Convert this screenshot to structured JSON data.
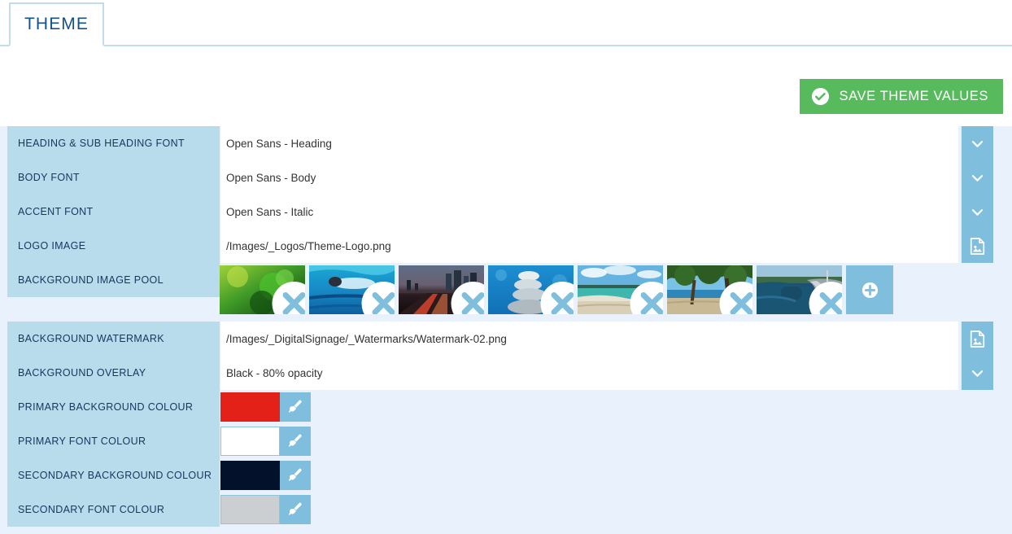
{
  "tab": {
    "label": "THEME"
  },
  "toolbar": {
    "save_label": "SAVE THEME VALUES",
    "save_color": "#57bb5e",
    "save_icon": "check-circle-icon"
  },
  "colors": {
    "label_bg": "#b9dcec",
    "table_bg": "#e9f2fc",
    "action_bg": "#7fbedd",
    "label_text": "#16365f",
    "tab_text": "#15528c",
    "tab_border": "#bfdeea"
  },
  "rows": [
    {
      "label": "HEADING & SUB HEADING FONT",
      "value": "Open Sans - Heading",
      "action_icon": "chevron-down-icon",
      "type": "select"
    },
    {
      "label": "BODY FONT",
      "value": "Open Sans - Body",
      "action_icon": "chevron-down-icon",
      "type": "select"
    },
    {
      "label": "ACCENT FONT",
      "value": "Open Sans - Italic",
      "action_icon": "chevron-down-icon",
      "type": "select"
    },
    {
      "label": "LOGO IMAGE",
      "value": "/Images/_Logos/Theme-Logo.png",
      "action_icon": "image-picker-icon",
      "type": "image"
    }
  ],
  "image_pool": {
    "label": "BACKGROUND IMAGE POOL",
    "add_icon": "plus-circle-icon",
    "remove_icon": "remove-circle-icon",
    "thumbnails": [
      {
        "name": "clover-leaf-thumbnail"
      },
      {
        "name": "swimmer-underwater-thumbnail"
      },
      {
        "name": "city-highway-night-thumbnail"
      },
      {
        "name": "stacked-stones-thumbnail"
      },
      {
        "name": "beach-coastline-thumbnail"
      },
      {
        "name": "trees-by-sea-thumbnail"
      },
      {
        "name": "riverside-path-thumbnail"
      }
    ]
  },
  "rows_after_pool": [
    {
      "label": "BACKGROUND WATERMARK",
      "value": "/Images/_DigitalSignage/_Watermarks/Watermark-02.png",
      "action_icon": "image-picker-icon",
      "type": "image"
    },
    {
      "label": "BACKGROUND OVERLAY",
      "value": "Black - 80% opacity",
      "action_icon": "chevron-down-icon",
      "type": "select"
    }
  ],
  "colour_rows": [
    {
      "label": "PRIMARY BACKGROUND COLOUR",
      "swatch": "#e32119",
      "bordered": false,
      "picker_icon": "paintbrush-icon"
    },
    {
      "label": "PRIMARY FONT COLOUR",
      "swatch": "#ffffff",
      "bordered": true,
      "picker_icon": "paintbrush-icon"
    },
    {
      "label": "SECONDARY BACKGROUND COLOUR",
      "swatch": "#04112b",
      "bordered": false,
      "picker_icon": "paintbrush-icon"
    },
    {
      "label": "SECONDARY FONT COLOUR",
      "swatch": "#cccfd1",
      "bordered": true,
      "picker_icon": "paintbrush-icon"
    }
  ]
}
